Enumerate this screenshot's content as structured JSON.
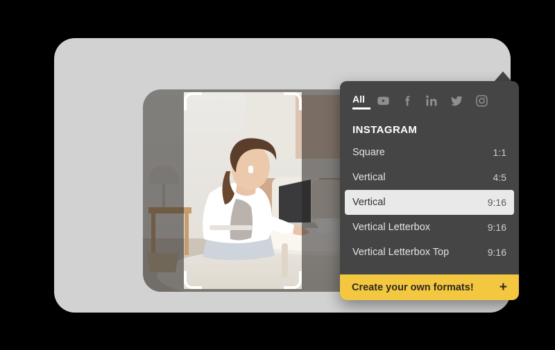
{
  "editor": {
    "photo_alt": "woman sitting on floor working on laptop at coffee table in living room",
    "crop_overlay_name": "crop-selection"
  },
  "panel": {
    "tabs": [
      {
        "label": "All",
        "icon": "all-text",
        "active": true
      },
      {
        "label": "YouTube",
        "icon": "youtube-icon",
        "active": false
      },
      {
        "label": "Facebook",
        "icon": "facebook-icon",
        "active": false
      },
      {
        "label": "LinkedIn",
        "icon": "linkedin-icon",
        "active": false
      },
      {
        "label": "Twitter",
        "icon": "twitter-icon",
        "active": false
      },
      {
        "label": "Instagram",
        "icon": "instagram-icon",
        "active": false
      }
    ],
    "group_title": "INSTAGRAM",
    "formats": [
      {
        "name": "Square",
        "ratio": "1:1",
        "selected": false
      },
      {
        "name": "Vertical",
        "ratio": "4:5",
        "selected": false
      },
      {
        "name": "Vertical",
        "ratio": "9:16",
        "selected": true
      },
      {
        "name": "Vertical Letterbox",
        "ratio": "9:16",
        "selected": false
      },
      {
        "name": "Vertical Letterbox Top",
        "ratio": "9:16",
        "selected": false
      }
    ],
    "footer": {
      "label": "Create your own formats!",
      "plus": "+"
    }
  },
  "colors": {
    "background": "#000000",
    "card": "#d2d2d2",
    "panel": "#454545",
    "selected_row": "#e9e9e9",
    "accent_yellow": "#f3c73f",
    "crop_handle": "#ffffff"
  }
}
